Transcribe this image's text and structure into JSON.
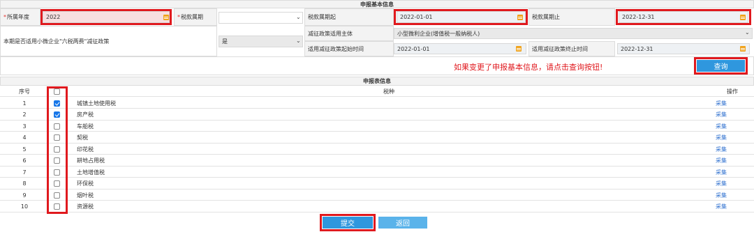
{
  "basic_info": {
    "title": "申报基本信息",
    "year_label": "所属年度",
    "year_value": "2022",
    "period_label": "税款属期",
    "period_value": "",
    "period_start_label": "税款属期起",
    "period_start_value": "2022-01-01",
    "period_end_label": "税款属期止",
    "period_end_value": "2022-12-31",
    "policy_question": "本期是否适用小微企业\"六税两费\"减征政策",
    "policy_value": "是",
    "subject_label": "减征政策适用主体",
    "subject_value": "小型微利企业(增值税一般纳税人)",
    "policy_start_label": "适用减征政策起始时间",
    "policy_start_value": "2022-01-01",
    "policy_end_label": "适用减征政策终止时间",
    "policy_end_value": "2022-12-31",
    "notice": "如果变更了申报基本信息，请点击查询按钮!",
    "query_button": "查询"
  },
  "form_table": {
    "title": "申报表信息",
    "col_seq": "序号",
    "col_tax": "税种",
    "col_op": "操作",
    "rows": [
      {
        "seq": "1",
        "tax": "城镇土地使用税",
        "checked": true,
        "op": "采集"
      },
      {
        "seq": "2",
        "tax": "房产税",
        "checked": true,
        "op": "采集"
      },
      {
        "seq": "3",
        "tax": "车船税",
        "checked": false,
        "op": "采集"
      },
      {
        "seq": "4",
        "tax": "契税",
        "checked": false,
        "op": "采集"
      },
      {
        "seq": "5",
        "tax": "印花税",
        "checked": false,
        "op": "采集"
      },
      {
        "seq": "6",
        "tax": "耕地占用税",
        "checked": false,
        "op": "采集"
      },
      {
        "seq": "7",
        "tax": "土地增值税",
        "checked": false,
        "op": "采集"
      },
      {
        "seq": "8",
        "tax": "环保税",
        "checked": false,
        "op": "采集"
      },
      {
        "seq": "9",
        "tax": "烟叶税",
        "checked": false,
        "op": "采集"
      },
      {
        "seq": "10",
        "tax": "资源税",
        "checked": false,
        "op": "采集"
      }
    ]
  },
  "actions": {
    "submit": "提交",
    "back": "返回"
  },
  "colors": {
    "accent_blue": "#2f97de",
    "highlight_red": "#e0191e",
    "checkbox_blue": "#1877e8",
    "calendar_orange": "#f0a31d"
  }
}
